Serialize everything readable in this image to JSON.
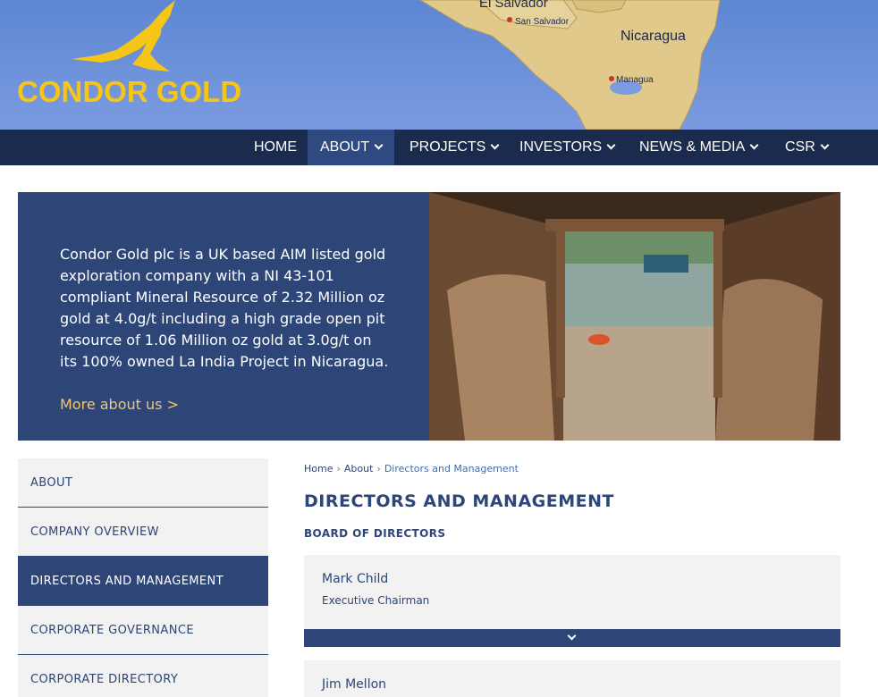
{
  "brand": {
    "name": "CONDOR GOLD",
    "color": "#f5c518"
  },
  "map": {
    "labels": [
      "El Salvador",
      "San Salvador",
      "Nicaragua",
      "Managua"
    ]
  },
  "nav": {
    "items": [
      {
        "label": "HOME",
        "dropdown": false,
        "active": false
      },
      {
        "label": "ABOUT",
        "dropdown": true,
        "active": true
      },
      {
        "label": "PROJECTS",
        "dropdown": true,
        "active": false
      },
      {
        "label": "INVESTORS",
        "dropdown": true,
        "active": false
      },
      {
        "label": "NEWS & MEDIA",
        "dropdown": true,
        "active": false
      },
      {
        "label": "CSR",
        "dropdown": true,
        "active": false
      }
    ]
  },
  "hero": {
    "text": "Condor Gold plc is a UK based AIM listed gold exploration company with a NI 43-101 compliant Mineral Resource of 2.32 Million oz gold at 4.0g/t including a high grade open pit resource of 1.06 Million oz gold at 3.0g/t on its 100% owned La India Project in Nicaragua.",
    "link": "More about us >"
  },
  "sidebar": {
    "items": [
      {
        "label": "ABOUT",
        "active": false
      },
      {
        "label": "COMPANY OVERVIEW",
        "active": false
      },
      {
        "label": "DIRECTORS AND MANAGEMENT",
        "active": true
      },
      {
        "label": "CORPORATE GOVERNANCE",
        "active": false
      },
      {
        "label": "CORPORATE DIRECTORY",
        "active": false
      }
    ]
  },
  "breadcrumb": {
    "home": "Home",
    "sep": "›",
    "about": "About",
    "current": "Directors and Management"
  },
  "page": {
    "title": "DIRECTORS AND MANAGEMENT",
    "section": "BOARD OF DIRECTORS"
  },
  "people": [
    {
      "name": "Mark Child",
      "role": "Executive Chairman"
    },
    {
      "name": "Jim Mellon",
      "role": ""
    }
  ],
  "colors": {
    "navy": "#1a2b4e",
    "primary": "#2d4577",
    "accent": "#f2c66d",
    "panel": "#f1f2f1"
  }
}
